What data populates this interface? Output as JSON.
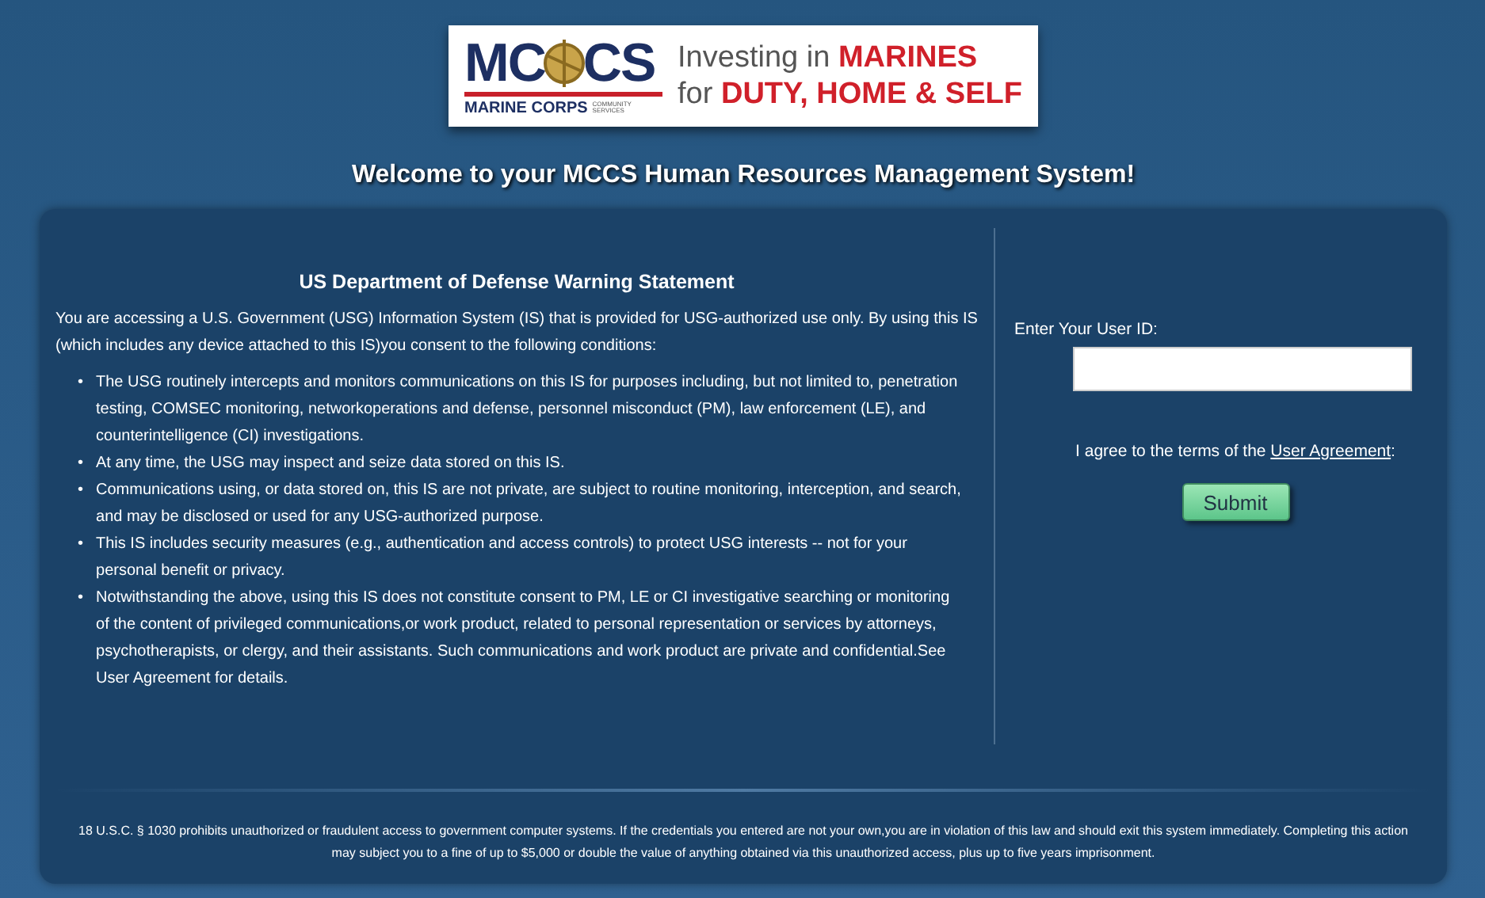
{
  "logo": {
    "left": "MC",
    "right": "CS",
    "subtitle": "MARINE CORPS",
    "small": "COMMUNITY SERVICES",
    "tagline": [
      {
        "lead": "Investing in",
        "highlight": "MARINES"
      },
      {
        "lead": "for",
        "highlight": "DUTY, HOME & SELF"
      }
    ]
  },
  "heading": "Welcome to your MCCS Human Resources Management System!",
  "warning": {
    "title": "US Department of Defense Warning Statement",
    "intro": "You are accessing a U.S. Government (USG) Information System (IS) that is provided for USG-authorized use only. By using this IS (which includes any device attached to this IS)you consent to the following conditions:",
    "marker": "•",
    "items": [
      "The USG routinely intercepts and monitors communications on this IS for purposes including, but not limited to, penetration testing, COMSEC monitoring, networkoperations and defense, personnel misconduct (PM), law enforcement (LE), and counterintelligence (CI) investigations.",
      "At any time, the USG may inspect and seize data stored on this IS.",
      "Communications using, or data stored on, this IS are not private, are subject to routine monitoring, interception, and search, and may be disclosed or used for any USG-authorized purpose.",
      "This IS includes security measures (e.g., authentication and access controls) to protect USG interests -- not for your personal benefit or privacy.",
      "Notwithstanding the above, using this IS does not constitute consent to PM, LE or CI investigative searching or monitoring of the content of privileged communications,or work product, related to personal representation or services by attorneys, psychotherapists, or clergy, and their assistants. Such communications and work product are private and confidential.See User Agreement for details."
    ]
  },
  "login": {
    "label": "Enter Your User ID:",
    "agree": {
      "text": "I agree to the terms of the",
      "link": "User Agreement",
      "tail": ":"
    },
    "submit": "Submit"
  },
  "footer": "18 U.S.C. § 1030 prohibits unauthorized or fraudulent access to government computer systems. If the credentials you entered are not your own,you are in violation of this law and should exit this system immediately. Completing this action may subject you to a fine of up to $5,000 or double the value of anything obtained via this unauthorized access, plus up to five years imprisonment."
}
